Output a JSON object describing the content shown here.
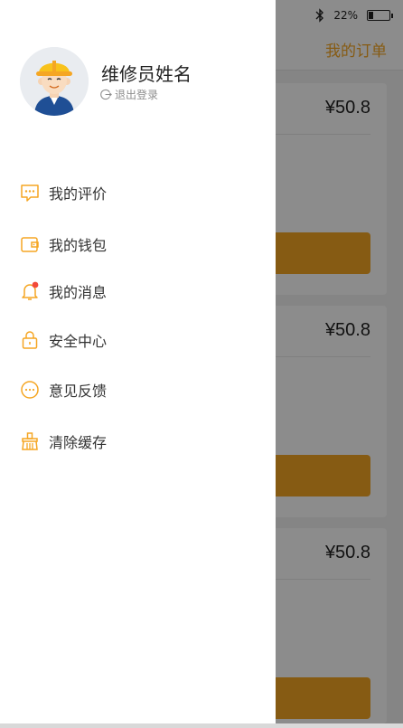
{
  "status": {
    "battery_text": "22%",
    "battery_level": 0.22
  },
  "nav": {
    "title": "我的订单"
  },
  "orders": [
    {
      "price": "¥50.8"
    },
    {
      "price": "¥50.8"
    },
    {
      "price": "¥50.8"
    }
  ],
  "drawer": {
    "user_name": "维修员姓名",
    "logout_label": "退出登录",
    "menu": [
      {
        "label": "我的评价",
        "icon": "comment-icon"
      },
      {
        "label": "我的钱包",
        "icon": "wallet-icon"
      },
      {
        "label": "我的消息",
        "icon": "bell-icon"
      },
      {
        "label": "安全中心",
        "icon": "lock-icon"
      },
      {
        "label": "意见反馈",
        "icon": "feedback-icon"
      },
      {
        "label": "清除缓存",
        "icon": "broom-icon"
      }
    ]
  },
  "colors": {
    "accent": "#f5a623",
    "badge": "#f24a3a"
  }
}
